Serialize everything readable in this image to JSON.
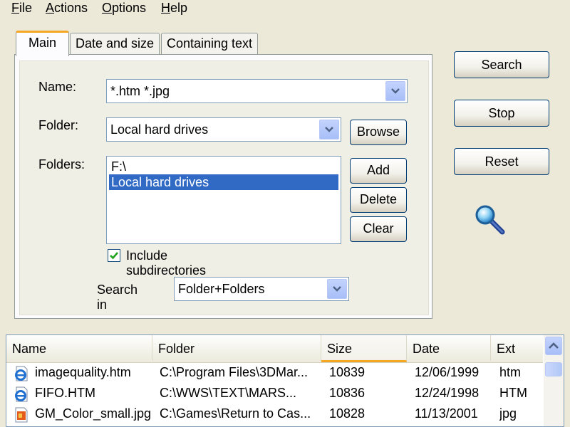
{
  "menu": [
    "File",
    "Actions",
    "Options",
    "Help"
  ],
  "tabs": [
    "Main",
    "Date and size",
    "Containing text"
  ],
  "main_tab": {
    "name_label": "Name:",
    "name_value": "*.htm *.jpg",
    "folder_label": "Folder:",
    "folder_value": "Local hard drives",
    "browse_label": "Browse",
    "folders_label": "Folders:",
    "folders_list": [
      "F:\\",
      "Local hard drives"
    ],
    "folders_selected": "Local hard drives",
    "add_label": "Add",
    "delete_label": "Delete",
    "clear_label": "Clear",
    "include_subdirs_label": "Include subdirectories",
    "include_subdirs_checked": true,
    "search_in_label": "Search in",
    "search_in_value": "Folder+Folders"
  },
  "actions": {
    "search_label": "Search",
    "stop_label": "Stop",
    "reset_label": "Reset",
    "status_icon": "magnifier-icon"
  },
  "results": {
    "columns": [
      "Name",
      "Folder",
      "Size",
      "Date",
      "Ext"
    ],
    "sorted_column": "Size",
    "rows": [
      {
        "icon": "ie-document-icon",
        "name": "imagequality.htm",
        "folder": "C:\\Program Files\\3DMar...",
        "size": "10839",
        "date": "12/06/1999",
        "ext": "htm"
      },
      {
        "icon": "ie-document-icon",
        "name": "FIFO.HTM",
        "folder": "C:\\WWS\\TEXT\\MARS...",
        "size": "10836",
        "date": "12/24/1998",
        "ext": "HTM"
      },
      {
        "icon": "image-file-icon",
        "name": "GM_Color_small.jpg",
        "folder": "C:\\Games\\Return to Cas...",
        "size": "10828",
        "date": "11/13/2001",
        "ext": "jpg"
      }
    ]
  },
  "colors": {
    "window_bg": "#ece9d8",
    "selection": "#316ac5",
    "tab_highlight": "#f5a623",
    "button_border": "#003c74"
  }
}
